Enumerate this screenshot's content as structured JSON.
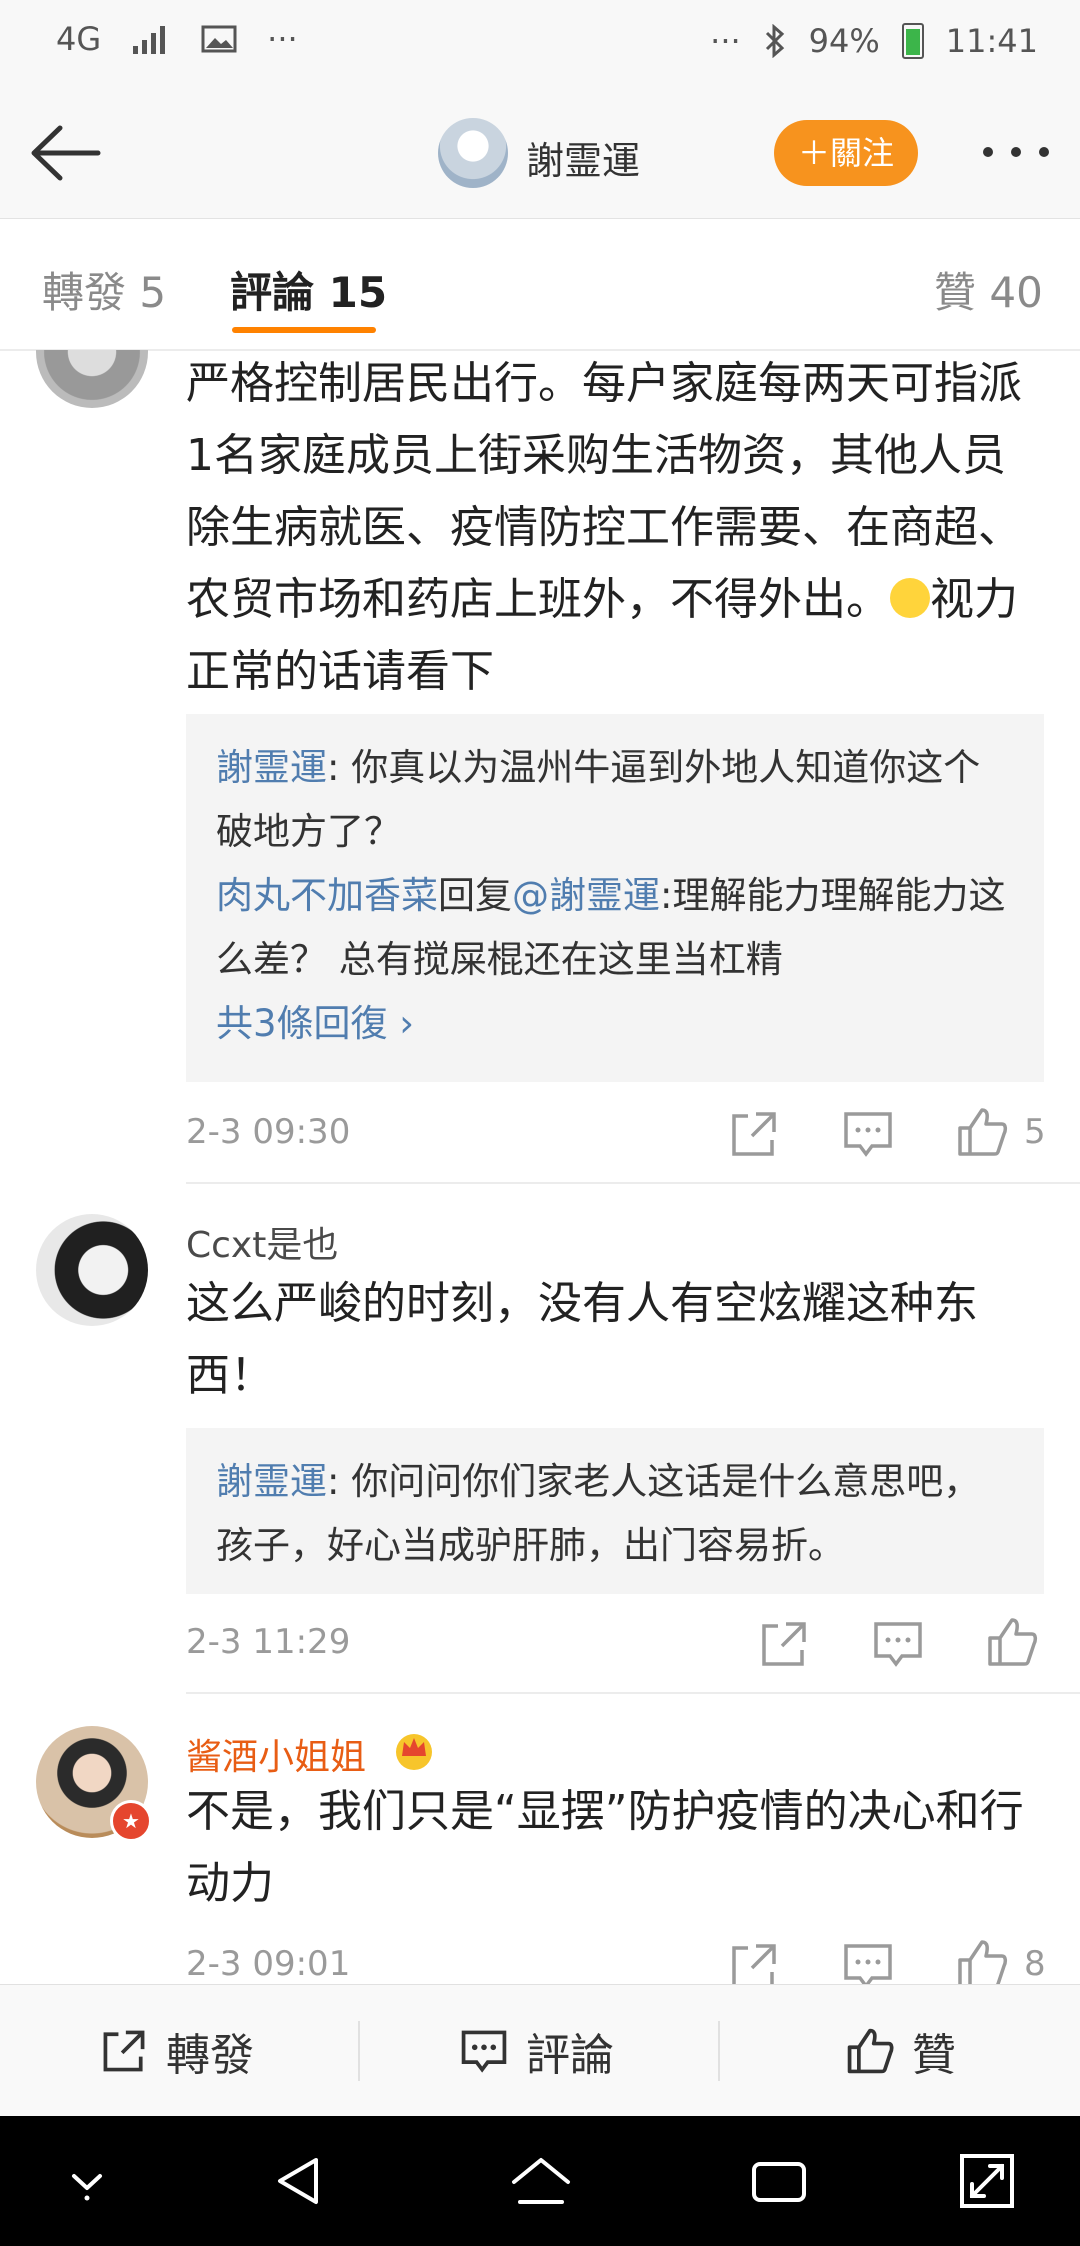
{
  "status_bar": {
    "network": "4G",
    "battery": "94%",
    "time": "11:41",
    "dots": "···"
  },
  "nav": {
    "title": "謝霊運",
    "follow_label": "＋關注"
  },
  "tabs": [
    {
      "label": "轉發 5"
    },
    {
      "label": "評論 15"
    },
    {
      "label": "贊 40"
    }
  ],
  "comments": [
    {
      "text": "严格控制居民出行。每户家庭每两天可指派1名家庭成员上街采购生活物资，其他人员除生病就医、疫情防控工作需要、在商超、农贸市场和药店上班外，不得外出。",
      "text_after_emoji": "视力正常的话请看下",
      "replies": [
        {
          "author": "謝霊運",
          "sep": ": ",
          "text": "你真以为温州牛逼到外地人知道你这个破地方了？"
        },
        {
          "author": "肉丸不加香菜",
          "mid": "回复",
          "mention": "@謝霊運",
          "text": ":理解能力理解能力这么差？ 总有搅屎棍还在这里当杠精"
        }
      ],
      "more_replies": "共3條回復 ›",
      "time": "2-3 09:30",
      "likes": "5"
    },
    {
      "author": "Ccxt是也",
      "text": "这么严峻的时刻，没有人有空炫耀这种东西！",
      "replies": [
        {
          "author": "謝霊運",
          "sep": ": ",
          "text": "你问问你们家老人这话是什么意思吧，孩子，好心当成驴肝肺，出门容易折。"
        }
      ],
      "time": "2-3 11:29",
      "likes": ""
    },
    {
      "author": "酱酒小姐姐",
      "text": "不是，我们只是“显摆”防护疫情的决心和行动力",
      "time": "2-3 09:01",
      "likes": "8"
    }
  ],
  "bottom_bar": {
    "repost": "轉發",
    "comment": "評論",
    "like": "贊"
  },
  "colors": {
    "accent": "#f7931e",
    "link": "#507daf",
    "tab_underline": "#ff8200",
    "author_vip": "#e85d14"
  }
}
